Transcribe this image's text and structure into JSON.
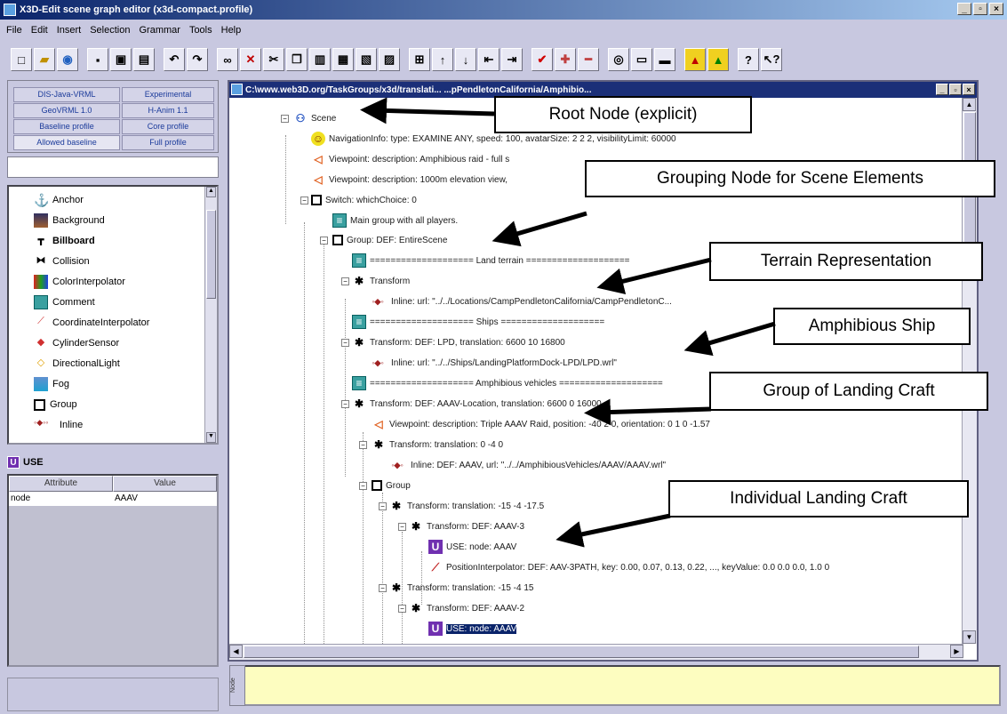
{
  "window": {
    "title": "X3D-Edit scene graph editor (x3d-compact.profile)",
    "controls": [
      "_",
      "▫",
      "×"
    ]
  },
  "menu": [
    "File",
    "Edit",
    "Insert",
    "Selection",
    "Grammar",
    "Tools",
    "Help"
  ],
  "profile_tabs": [
    {
      "label": "DIS-Java-VRML"
    },
    {
      "label": "Experimental"
    },
    {
      "label": "GeoVRML 1.0"
    },
    {
      "label": "H-Anim 1.1"
    },
    {
      "label": "Baseline profile"
    },
    {
      "label": "Core profile"
    },
    {
      "label": "Allowed baseline"
    },
    {
      "label": "Full profile"
    }
  ],
  "palette": [
    {
      "label": "Anchor"
    },
    {
      "label": "Background"
    },
    {
      "label": "Billboard"
    },
    {
      "label": "Collision"
    },
    {
      "label": "ColorInterpolator"
    },
    {
      "label": "Comment"
    },
    {
      "label": "CoordinateInterpolator"
    },
    {
      "label": "CylinderSensor"
    },
    {
      "label": "DirectionalLight"
    },
    {
      "label": "Fog"
    },
    {
      "label": "Group"
    },
    {
      "label": "Inline"
    }
  ],
  "selected_node": {
    "badge": "U",
    "name": "USE",
    "attr_header": {
      "attribute": "Attribute",
      "value": "Value"
    },
    "attributes": [
      {
        "name": "node",
        "value": "AAAV"
      }
    ]
  },
  "tree_window": {
    "title": "C:\\www.web3D.org/TaskGroups/x3d/translati... ...pPendletonCalifornia/Amphibio..."
  },
  "tree": [
    {
      "text": "Scene"
    },
    {
      "text": "NavigationInfo:  type: EXAMINE ANY,  speed: 100,  avatarSize: 2 2 2,  visibilityLimit: 60000"
    },
    {
      "text": "Viewpoint:  description: Amphibious raid - full s"
    },
    {
      "text": "Viewpoint:  description: 1000m elevation view,"
    },
    {
      "text": "Switch:  whichChoice: 0"
    },
    {
      "text": "Main group with all players."
    },
    {
      "text": "Group:  DEF: EntireScene"
    },
    {
      "text": "====================  Land terrain  ===================="
    },
    {
      "text": "Transform"
    },
    {
      "text": "Inline:  url: \"../../Locations/CampPendletonCalifornia/CampPendletonC..."
    },
    {
      "text": "====================  Ships  ===================="
    },
    {
      "text": "Transform:  DEF: LPD,  translation: 6600 10 16800"
    },
    {
      "text": "Inline:  url: \"../../Ships/LandingPlatformDock-LPD/LPD.wrl\""
    },
    {
      "text": "====================  Amphibious vehicles  ===================="
    },
    {
      "text": "Transform:  DEF: AAAV-Location,  translation: 6600 0 16000"
    },
    {
      "text": "Viewpoint:  description: Triple AAAV Raid,  position: -40 2 0,  orientation: 0 1 0 -1.57"
    },
    {
      "text": "Transform:  translation: 0 -4 0"
    },
    {
      "text": "Inline:  DEF: AAAV,  url: \"../../AmphibiousVehicles/AAAV/AAAV.wrl\""
    },
    {
      "text": "Group"
    },
    {
      "text": "Transform:  translation: -15 -4 -17.5"
    },
    {
      "text": "Transform:  DEF: AAAV-3"
    },
    {
      "text": "USE:  node: AAAV"
    },
    {
      "text": "PositionInterpolator:  DEF: AAV-3PATH,  key: 0.00, 0.07, 0.13, 0.22, ...,  keyValue: 0.0 0.0  0.0,  1.0 0"
    },
    {
      "text": "Transform:  translation: -15 -4 15"
    },
    {
      "text": "Transform:  DEF: AAAV-2"
    },
    {
      "text": "USE:  node: AAAV"
    }
  ],
  "callouts": [
    {
      "text": "Root Node (explicit)"
    },
    {
      "text": "Grouping Node for Scene Elements"
    },
    {
      "text": "Terrain Representation"
    },
    {
      "text": "Amphibious Ship"
    },
    {
      "text": "Group of Landing Craft"
    },
    {
      "text": "Individual Landing Craft"
    }
  ],
  "bottom_label": "Node"
}
